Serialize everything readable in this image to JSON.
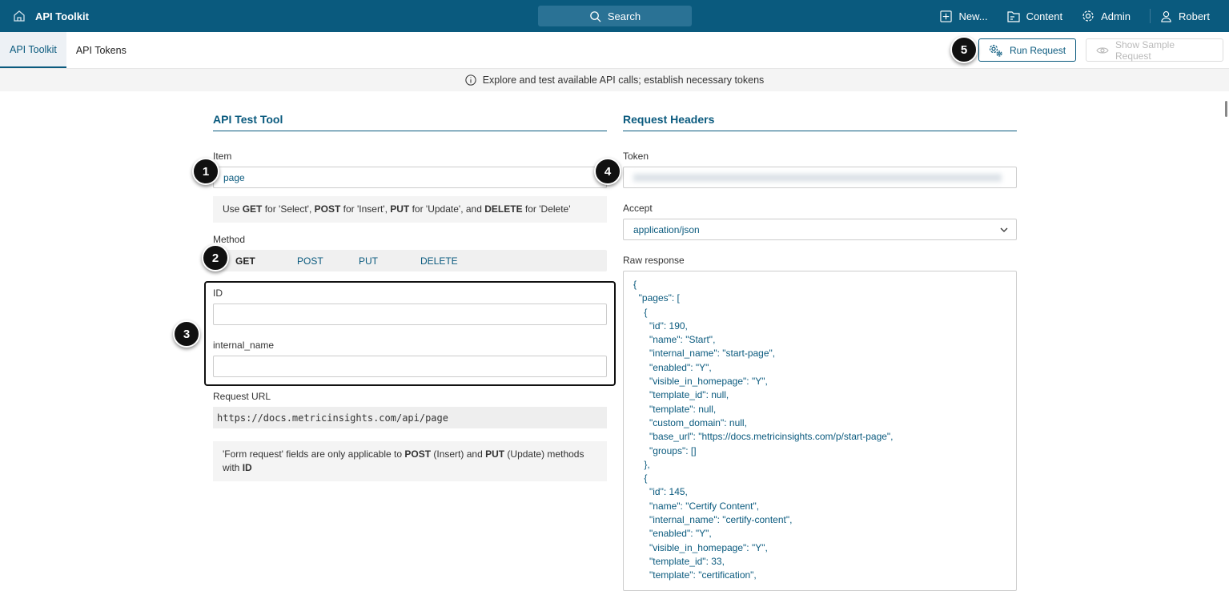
{
  "topbar": {
    "title": "API Toolkit",
    "search": "Search",
    "nav": {
      "new": "New...",
      "content": "Content",
      "admin": "Admin",
      "user": "Robert"
    }
  },
  "tabs": [
    {
      "label": "API Toolkit",
      "active": true
    },
    {
      "label": "API Tokens",
      "active": false
    }
  ],
  "actions": {
    "run": "Run Request",
    "sample": "Show Sample Request"
  },
  "info": "Explore and test available API calls; establish necessary tokens",
  "left": {
    "title": "API Test Tool",
    "item_label": "Item",
    "item_value": "page",
    "method_note": {
      "p1": "Use ",
      "get": "GET",
      "p2": " for 'Select', ",
      "post": "POST",
      "p3": " for 'Insert', ",
      "put": "PUT",
      "p4": " for 'Update', and ",
      "del": "DELETE",
      "p5": " for 'Delete'"
    },
    "method_label": "Method",
    "methods": [
      "GET",
      "POST",
      "PUT",
      "DELETE"
    ],
    "selected_method": "GET",
    "id_label": "ID",
    "id_value": "",
    "internal_label": "internal_name",
    "internal_value": "",
    "url_label": "Request URL",
    "url": "https://docs.metricinsights.com/api/page",
    "form_note": {
      "p1": "'Form request' fields are only applicable to ",
      "post": "POST",
      "p2": " (Insert) and ",
      "put": "PUT",
      "p3": " (Update) methods with ",
      "id": "ID"
    }
  },
  "right": {
    "title": "Request Headers",
    "token_label": "Token",
    "accept_label": "Accept",
    "accept_value": "application/json",
    "raw_label": "Raw response",
    "raw": "{\n  \"pages\": [\n    {\n      \"id\": 190,\n      \"name\": \"Start\",\n      \"internal_name\": \"start-page\",\n      \"enabled\": \"Y\",\n      \"visible_in_homepage\": \"Y\",\n      \"template_id\": null,\n      \"template\": null,\n      \"custom_domain\": null,\n      \"base_url\": \"https://docs.metricinsights.com/p/start-page\",\n      \"groups\": []\n    },\n    {\n      \"id\": 145,\n      \"name\": \"Certify Content\",\n      \"internal_name\": \"certify-content\",\n      \"enabled\": \"Y\",\n      \"visible_in_homepage\": \"Y\",\n      \"template_id\": 33,\n      \"template\": \"certification\","
  },
  "badges": [
    "1",
    "2",
    "3",
    "4",
    "5"
  ]
}
